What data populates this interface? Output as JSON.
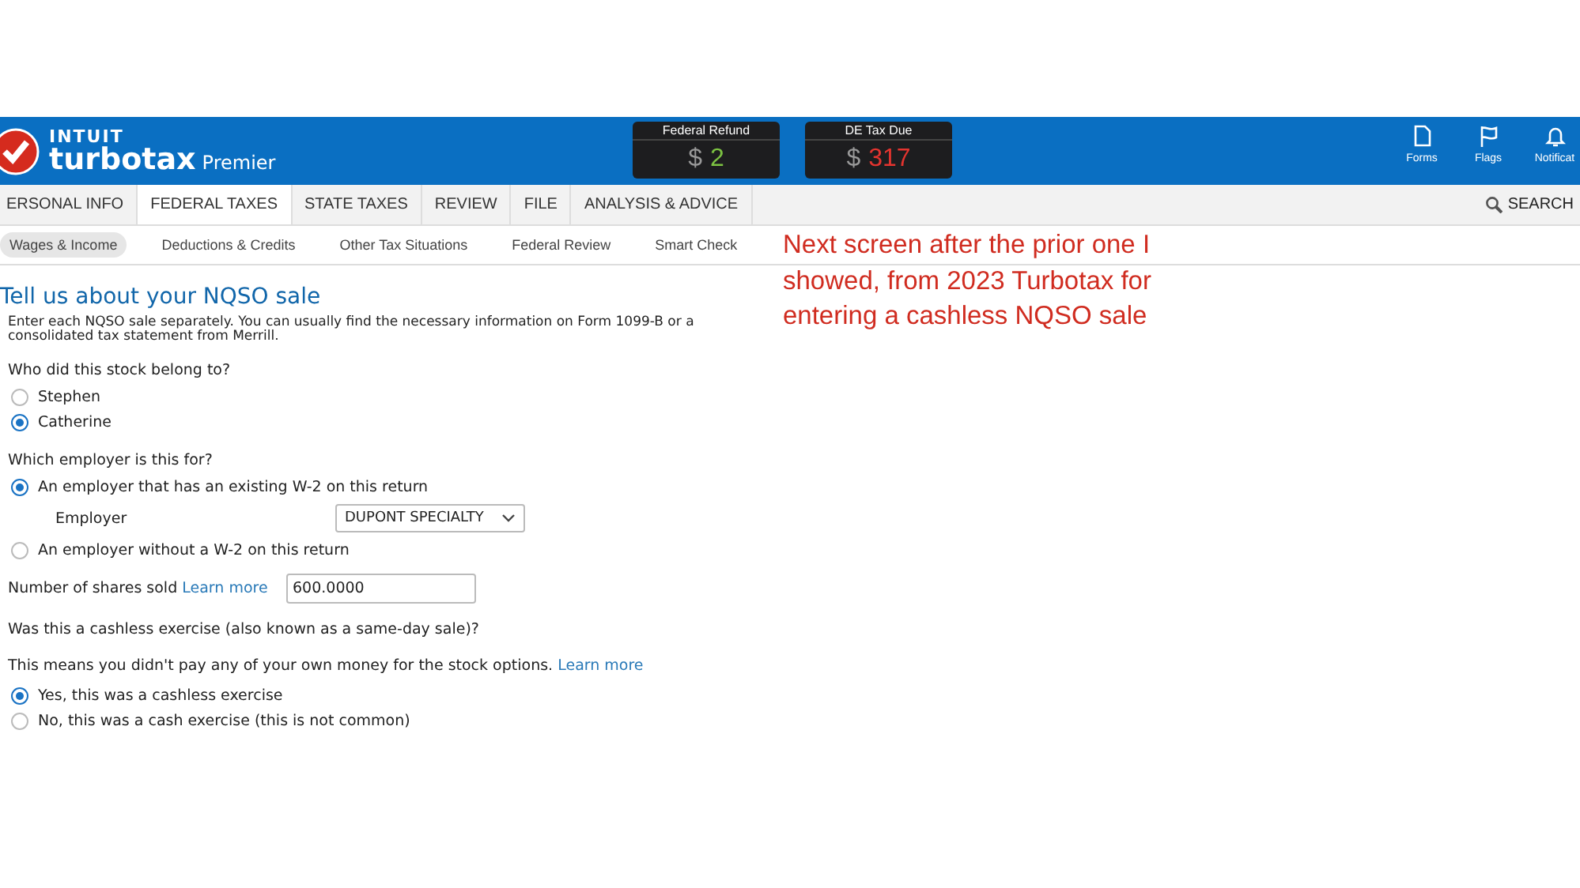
{
  "header": {
    "logo": {
      "brand": "INTUIT",
      "product": "turbotax",
      "edition": "Premier"
    },
    "summaries": [
      {
        "label": "Federal Refund",
        "currency": "$",
        "amount": "2",
        "kind": "refund"
      },
      {
        "label": "DE Tax Due",
        "currency": "$",
        "amount": "317",
        "kind": "due"
      }
    ],
    "tools": [
      {
        "label": "Forms",
        "kind": "document"
      },
      {
        "label": "Flags",
        "kind": "flag"
      },
      {
        "label": "Notificat",
        "kind": "bell"
      }
    ]
  },
  "tabs": [
    {
      "label": "ERSONAL INFO",
      "selected": false
    },
    {
      "label": "FEDERAL TAXES",
      "selected": true
    },
    {
      "label": "STATE TAXES",
      "selected": false
    },
    {
      "label": "REVIEW",
      "selected": false
    },
    {
      "label": "FILE",
      "selected": false
    },
    {
      "label": "ANALYSIS & ADVICE",
      "selected": false
    }
  ],
  "search": {
    "label": "SEARCH"
  },
  "subnav": [
    {
      "label": "Wages & Income",
      "selected": true
    },
    {
      "label": "Deductions & Credits",
      "selected": false
    },
    {
      "label": "Other Tax Situations",
      "selected": false
    },
    {
      "label": "Federal Review",
      "selected": false
    },
    {
      "label": "Smart Check",
      "selected": false
    }
  ],
  "page": {
    "title": "Tell us about your NQSO sale",
    "intro": "Enter each NQSO sale separately. You can usually find the necessary information on Form 1099-B or a consolidated tax statement from Merrill.",
    "rows": [
      {
        "kind": "question",
        "text": "Who did this stock belong to?"
      },
      {
        "kind": "radio",
        "label": "Stephen",
        "selected": false
      },
      {
        "kind": "radio",
        "label": "Catherine",
        "selected": true
      },
      {
        "kind": "question",
        "text": "Which employer is this for?"
      },
      {
        "kind": "radio",
        "label": "An employer that has an existing W-2 on this return",
        "selected": true
      },
      {
        "kind": "select",
        "label": "Employer",
        "value": "DUPONT SPECIALTY"
      },
      {
        "kind": "radio",
        "label": "An employer without a W-2 on this return",
        "selected": false
      },
      {
        "kind": "input",
        "label": "Number of shares sold",
        "link": "Learn more",
        "value": "600.0000"
      },
      {
        "kind": "question",
        "text": "Was this a cashless exercise (also known as a same-day sale)?"
      },
      {
        "kind": "note",
        "text": "This means you didn't pay any of your own money for the stock options.",
        "link": "Learn more"
      },
      {
        "kind": "radio",
        "label": "Yes, this was a cashless exercise",
        "selected": true
      },
      {
        "kind": "radio",
        "label": "No, this was a cash exercise (this is not common)",
        "selected": false
      }
    ]
  },
  "annotation": "Next screen after the prior one I showed, from 2023 Turbotax for entering a cashless NQSO sale"
}
